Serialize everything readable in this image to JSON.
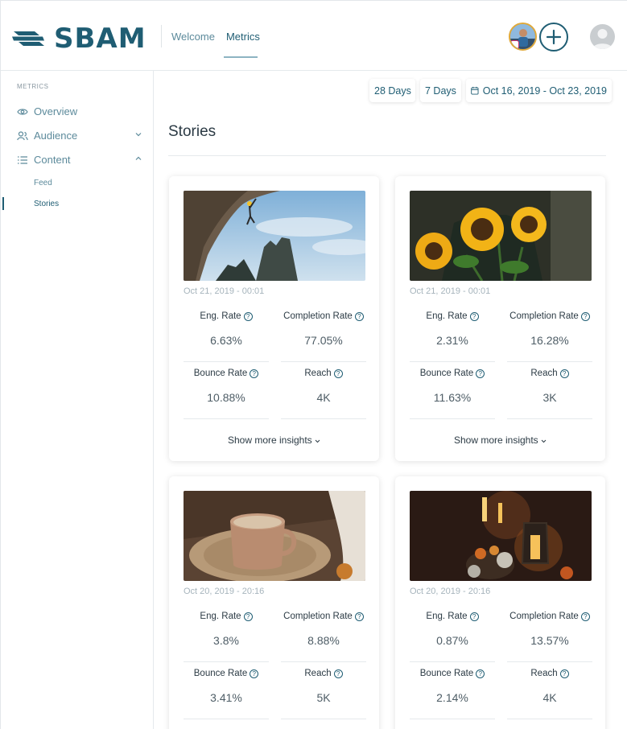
{
  "header": {
    "logo_text": "SBAM",
    "nav": [
      {
        "label": "Welcome"
      },
      {
        "label": "Metrics"
      }
    ],
    "brand_color": "#1f5d73"
  },
  "sidebar": {
    "section_label": "METRICS",
    "items": [
      {
        "label": "Overview",
        "icon": "eye-icon"
      },
      {
        "label": "Audience",
        "icon": "users-icon"
      },
      {
        "label": "Content",
        "icon": "list-icon"
      }
    ],
    "subitems": [
      {
        "label": "Feed"
      },
      {
        "label": "Stories"
      }
    ]
  },
  "toolbar": {
    "range_28": "28 Days",
    "range_7": "7 Days",
    "date_range": "Oct 16, 2019 - Oct 23, 2019"
  },
  "main": {
    "title": "Stories",
    "labels": {
      "eng_rate": "Eng. Rate",
      "completion_rate": "Completion Rate",
      "bounce_rate": "Bounce Rate",
      "reach": "Reach",
      "show_more": "Show more insights"
    },
    "stories": [
      {
        "date": "Oct 21, 2019 - 00:01",
        "image": "rock-climber",
        "eng_rate": "6.63%",
        "completion_rate": "77.05%",
        "bounce_rate": "10.88%",
        "reach": "4K"
      },
      {
        "date": "Oct 21, 2019 - 00:01",
        "image": "sunflowers",
        "eng_rate": "2.31%",
        "completion_rate": "16.28%",
        "bounce_rate": "11.63%",
        "reach": "3K"
      },
      {
        "date": "Oct 20, 2019 - 20:16",
        "image": "coffee-cup",
        "eng_rate": "3.8%",
        "completion_rate": "8.88%",
        "bounce_rate": "3.41%",
        "reach": "5K"
      },
      {
        "date": "Oct 20, 2019 - 20:16",
        "image": "autumn-lanterns",
        "eng_rate": "0.87%",
        "completion_rate": "13.57%",
        "bounce_rate": "2.14%",
        "reach": "4K"
      }
    ]
  }
}
